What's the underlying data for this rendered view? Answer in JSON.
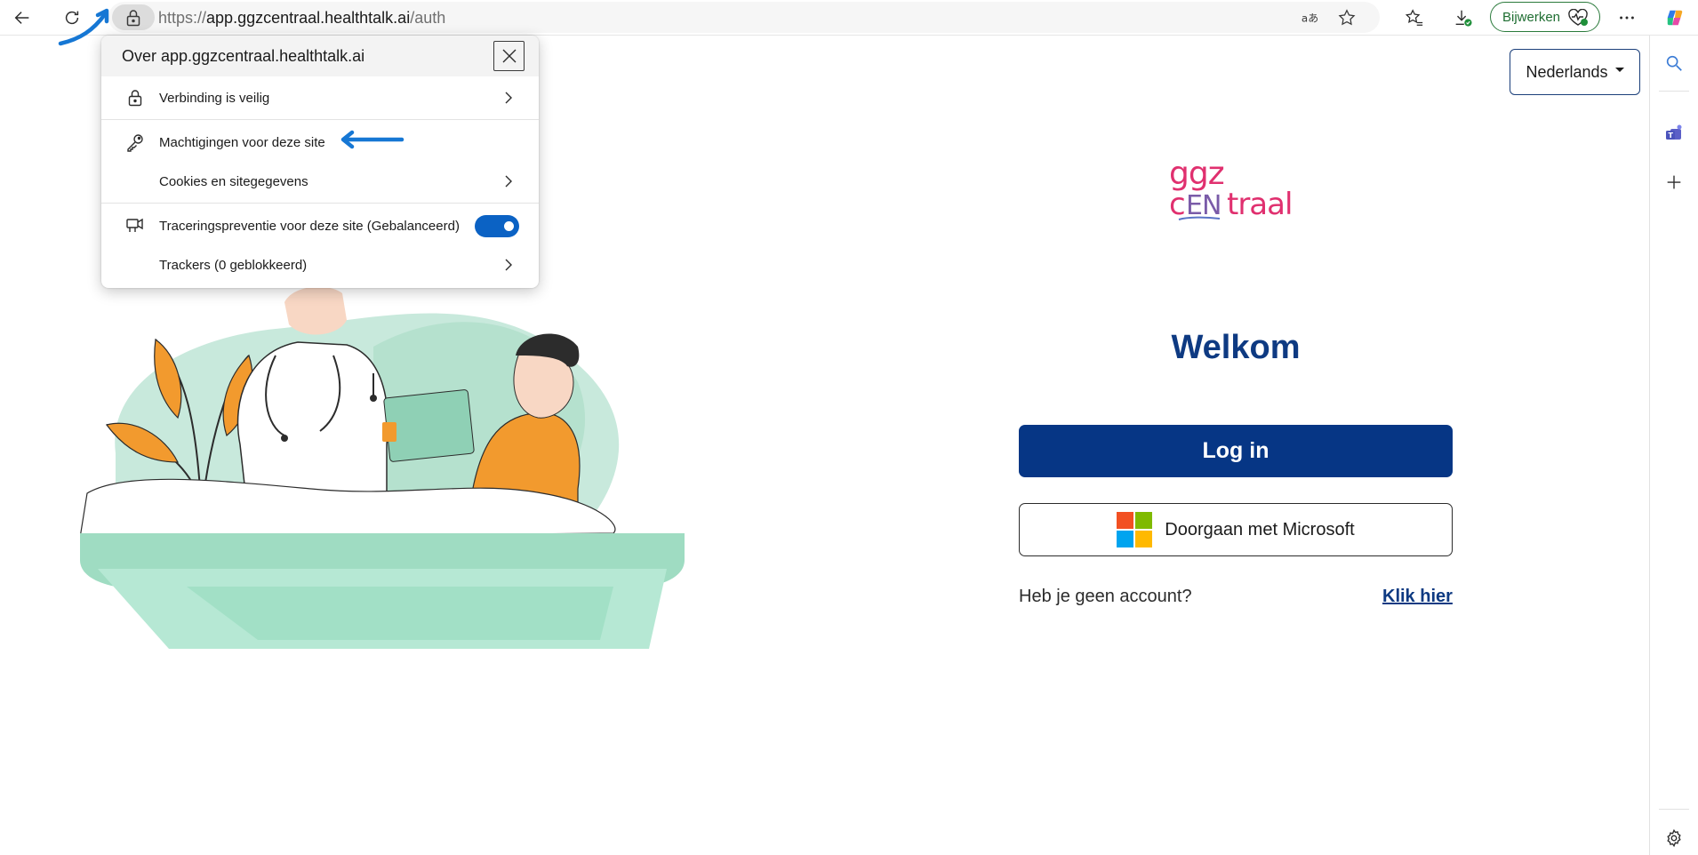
{
  "browser": {
    "url_prefix": "https://",
    "url_host": "app.ggzcentraal.healthtalk.ai",
    "url_path": "/auth",
    "update_label": "Bijwerken",
    "icons": [
      "back-icon",
      "refresh-icon",
      "lock-icon",
      "read-aloud-icon",
      "favorite-star-icon",
      "favorites-icon",
      "downloads-icon",
      "browser-essentials-icon",
      "more-icon",
      "copilot-icon"
    ]
  },
  "sidebar": {
    "icons": [
      "search-icon",
      "teams-icon",
      "add-icon",
      "settings-icon"
    ]
  },
  "site_info": {
    "title": "Over app.ggzcentraal.healthtalk.ai",
    "connection_label": "Verbinding is veilig",
    "permissions_label": "Machtigingen voor deze site",
    "cookies_label": "Cookies en sitegegevens",
    "tracking_label": "Traceringspreventie voor deze site (Gebalanceerd)",
    "tracking_enabled": true,
    "trackers_label": "Trackers (0 geblokkeerd)"
  },
  "page": {
    "language_label": "Nederlands",
    "logo_text": "ggz centraal",
    "welcome": "Welkom",
    "login_label": "Log in",
    "microsoft_label": "Doorgaan met Microsoft",
    "no_account_text": "Heb je geen account?",
    "click_here_label": "Klik hier"
  },
  "colors": {
    "brand_navy": "#063685",
    "brand_pink": "#e0306f",
    "toggle_blue": "#0b62c4",
    "annotation_blue": "#1677d4",
    "illustration_green": "#a8dcc6",
    "illustration_orange": "#f29a2e"
  }
}
